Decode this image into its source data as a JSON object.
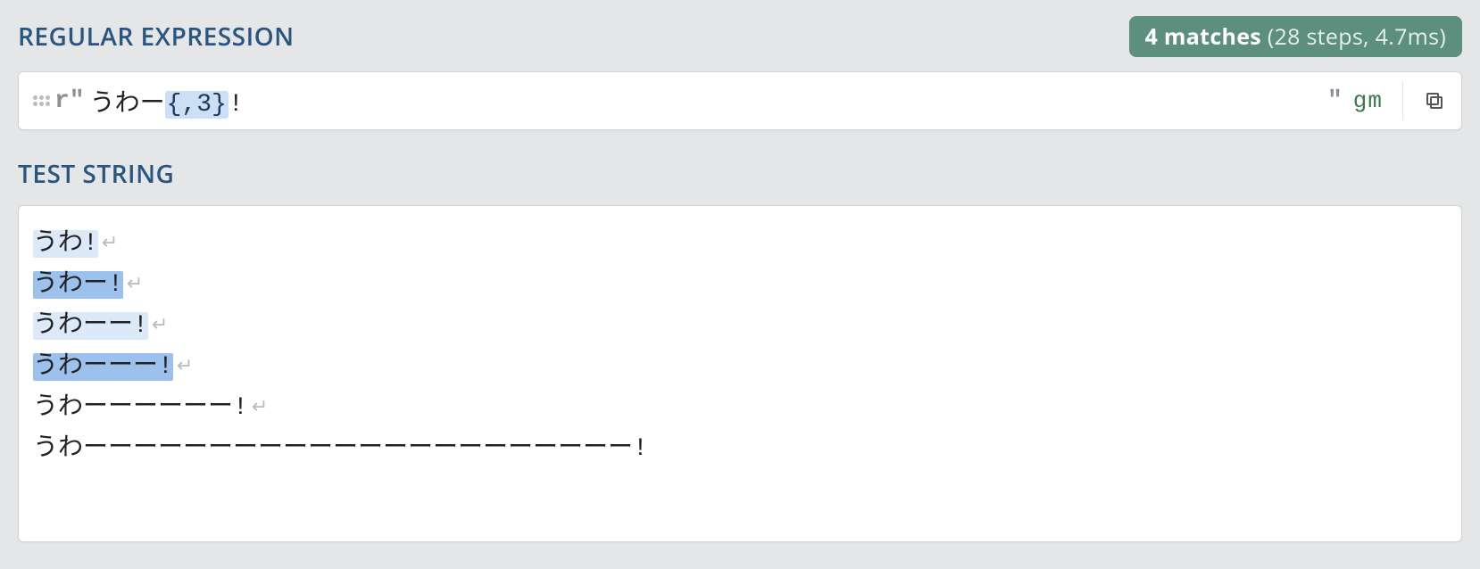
{
  "regex_section": {
    "title": "REGULAR EXPRESSION",
    "match_summary": {
      "count_text": "4 matches",
      "details": "(28 steps, 4.7ms)"
    },
    "open_delim": "r\"",
    "close_delim": "\"",
    "flags": "gm",
    "pattern_prefix": " うわー",
    "pattern_quant": "{,3}",
    "pattern_suffix": "!"
  },
  "test_section": {
    "title": "TEST STRING",
    "lines": [
      {
        "text": "うわ!",
        "highlight": "even",
        "newline": true
      },
      {
        "text": "うわー!",
        "highlight": "odd",
        "newline": true
      },
      {
        "text": "うわーー!",
        "highlight": "even",
        "newline": true
      },
      {
        "text": "うわーーー!",
        "highlight": "odd",
        "newline": true
      },
      {
        "text": "うわーーーーーー!",
        "highlight": null,
        "newline": true
      },
      {
        "text": "うわーーーーーーーーーーーーーーーーーーーーーー!",
        "highlight": null,
        "newline": false
      }
    ]
  },
  "glyphs": {
    "newline": "↵"
  }
}
